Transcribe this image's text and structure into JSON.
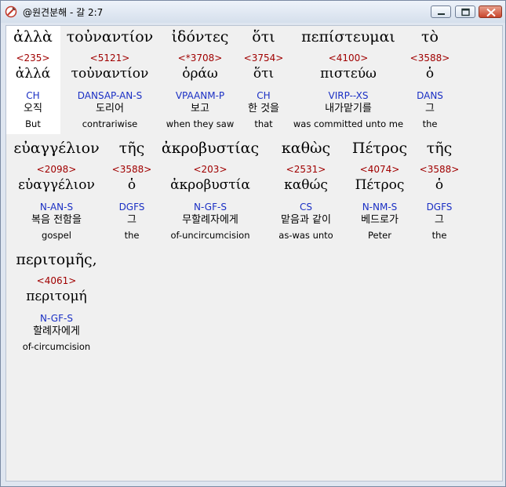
{
  "window": {
    "title": "@원견분해 - 갈 2:7"
  },
  "words": [
    {
      "greek": "ἀλλὰ",
      "strong": "<235>",
      "lemma": "ἀλλά",
      "parse": "CH",
      "korean": "오직",
      "english": "But"
    },
    {
      "greek": "τοὐναντίον",
      "strong": "<5121>",
      "lemma": "τοὐναντίον",
      "parse": "DANSAP-AN-S",
      "korean": "도리어",
      "english": "contrariwise"
    },
    {
      "greek": "ἰδόντες",
      "strong": "<*3708>",
      "lemma": "ὁράω",
      "parse": "VPAANM-P",
      "korean": "보고",
      "english": "when they saw"
    },
    {
      "greek": "ὅτι",
      "strong": "<3754>",
      "lemma": "ὅτι",
      "parse": "CH",
      "korean": "한 것을",
      "english": "that"
    },
    {
      "greek": "πεπίστευμαι",
      "strong": "<4100>",
      "lemma": "πιστεύω",
      "parse": "VIRP--XS",
      "korean": "내가맡기를",
      "english": "was committed unto me"
    },
    {
      "greek": "τὸ",
      "strong": "<3588>",
      "lemma": "ὁ",
      "parse": "DANS",
      "korean": "그",
      "english": "the"
    },
    {
      "greek": "εὐαγγέλιον",
      "strong": "<2098>",
      "lemma": "εὐαγγέλιον",
      "parse": "N-AN-S",
      "korean": "복음 전함을",
      "english": "gospel"
    },
    {
      "greek": "τῆς",
      "strong": "<3588>",
      "lemma": "ὁ",
      "parse": "DGFS",
      "korean": "그",
      "english": "the"
    },
    {
      "greek": "ἀκροβυστίας",
      "strong": "<203>",
      "lemma": "ἀκροβυστία",
      "parse": "N-GF-S",
      "korean": "무할례자에게",
      "english": "of-uncircumcision"
    },
    {
      "greek": "καθὼς",
      "strong": "<2531>",
      "lemma": "καθώς",
      "parse": "CS",
      "korean": "맡음과 같이",
      "english": "as-was unto"
    },
    {
      "greek": "Πέτρος",
      "strong": "<4074>",
      "lemma": "Πέτρος",
      "parse": "N-NM-S",
      "korean": "베드로가",
      "english": "Peter"
    },
    {
      "greek": "τῆς",
      "strong": "<3588>",
      "lemma": "ὁ",
      "parse": "DGFS",
      "korean": "그",
      "english": "the"
    },
    {
      "greek": "περιτομῆς,",
      "strong": "<4061>",
      "lemma": "περιτομή",
      "parse": "N-GF-S",
      "korean": "할례자에게",
      "english": "of-circumcision"
    }
  ],
  "icons": {
    "app": "app-icon",
    "minimize": "minimize-icon",
    "maximize": "maximize-icon",
    "close": "close-icon"
  }
}
